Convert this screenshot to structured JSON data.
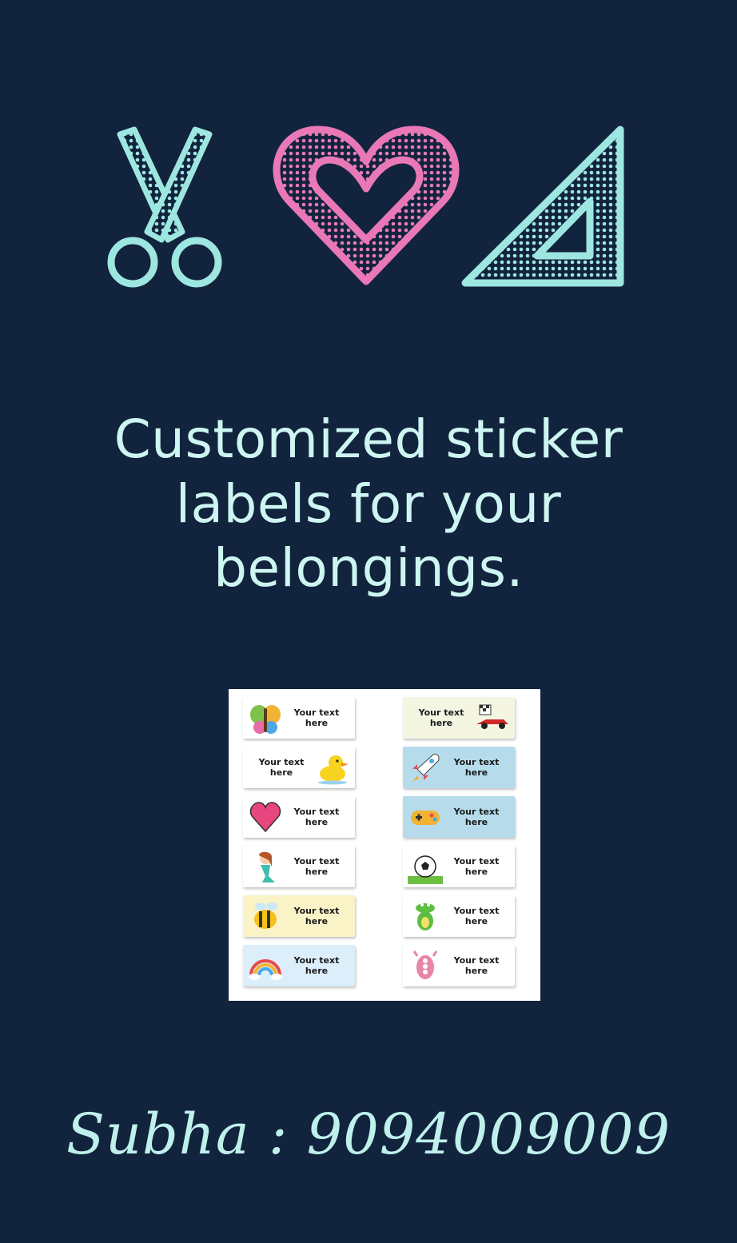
{
  "headline": {
    "line1": "Customized sticker",
    "line2": "labels for your",
    "line3": "belongings."
  },
  "icons": [
    "scissors-icon",
    "heart-icon",
    "set-square-icon"
  ],
  "colors": {
    "background": "#12233d",
    "accent_teal": "#9ee6e0",
    "accent_pink": "#e879b6",
    "text": "#cdf5f1"
  },
  "stickers": {
    "left": [
      {
        "text": "Your text here",
        "icon": "butterfly-icon",
        "bg": "#ffffff"
      },
      {
        "text": "Your text here",
        "icon": "duck-icon",
        "bg": "#ffffff"
      },
      {
        "text": "Your text here",
        "icon": "heart-icon",
        "bg": "#ffffff"
      },
      {
        "text": "Your text here",
        "icon": "mermaid-icon",
        "bg": "#ffffff"
      },
      {
        "text": "Your text here",
        "icon": "bee-icon",
        "bg": "#fbf3c8"
      },
      {
        "text": "Your text here",
        "icon": "rainbow-icon",
        "bg": "#dbeefa"
      }
    ],
    "right": [
      {
        "text": "Your text here",
        "icon": "racecar-icon",
        "bg": "#f4f6e2"
      },
      {
        "text": "Your text here",
        "icon": "rocket-icon",
        "bg": "#b6dcec"
      },
      {
        "text": "Your text here",
        "icon": "gamepad-icon",
        "bg": "#b6dcec"
      },
      {
        "text": "Your text here",
        "icon": "soccer-ball-icon",
        "bg": "#ffffff"
      },
      {
        "text": "Your text here",
        "icon": "crocodile-icon",
        "bg": "#ffffff"
      },
      {
        "text": "Your text here",
        "icon": "monster-icon",
        "bg": "#ffffff"
      }
    ]
  },
  "contact": "Subha : 9094009009"
}
